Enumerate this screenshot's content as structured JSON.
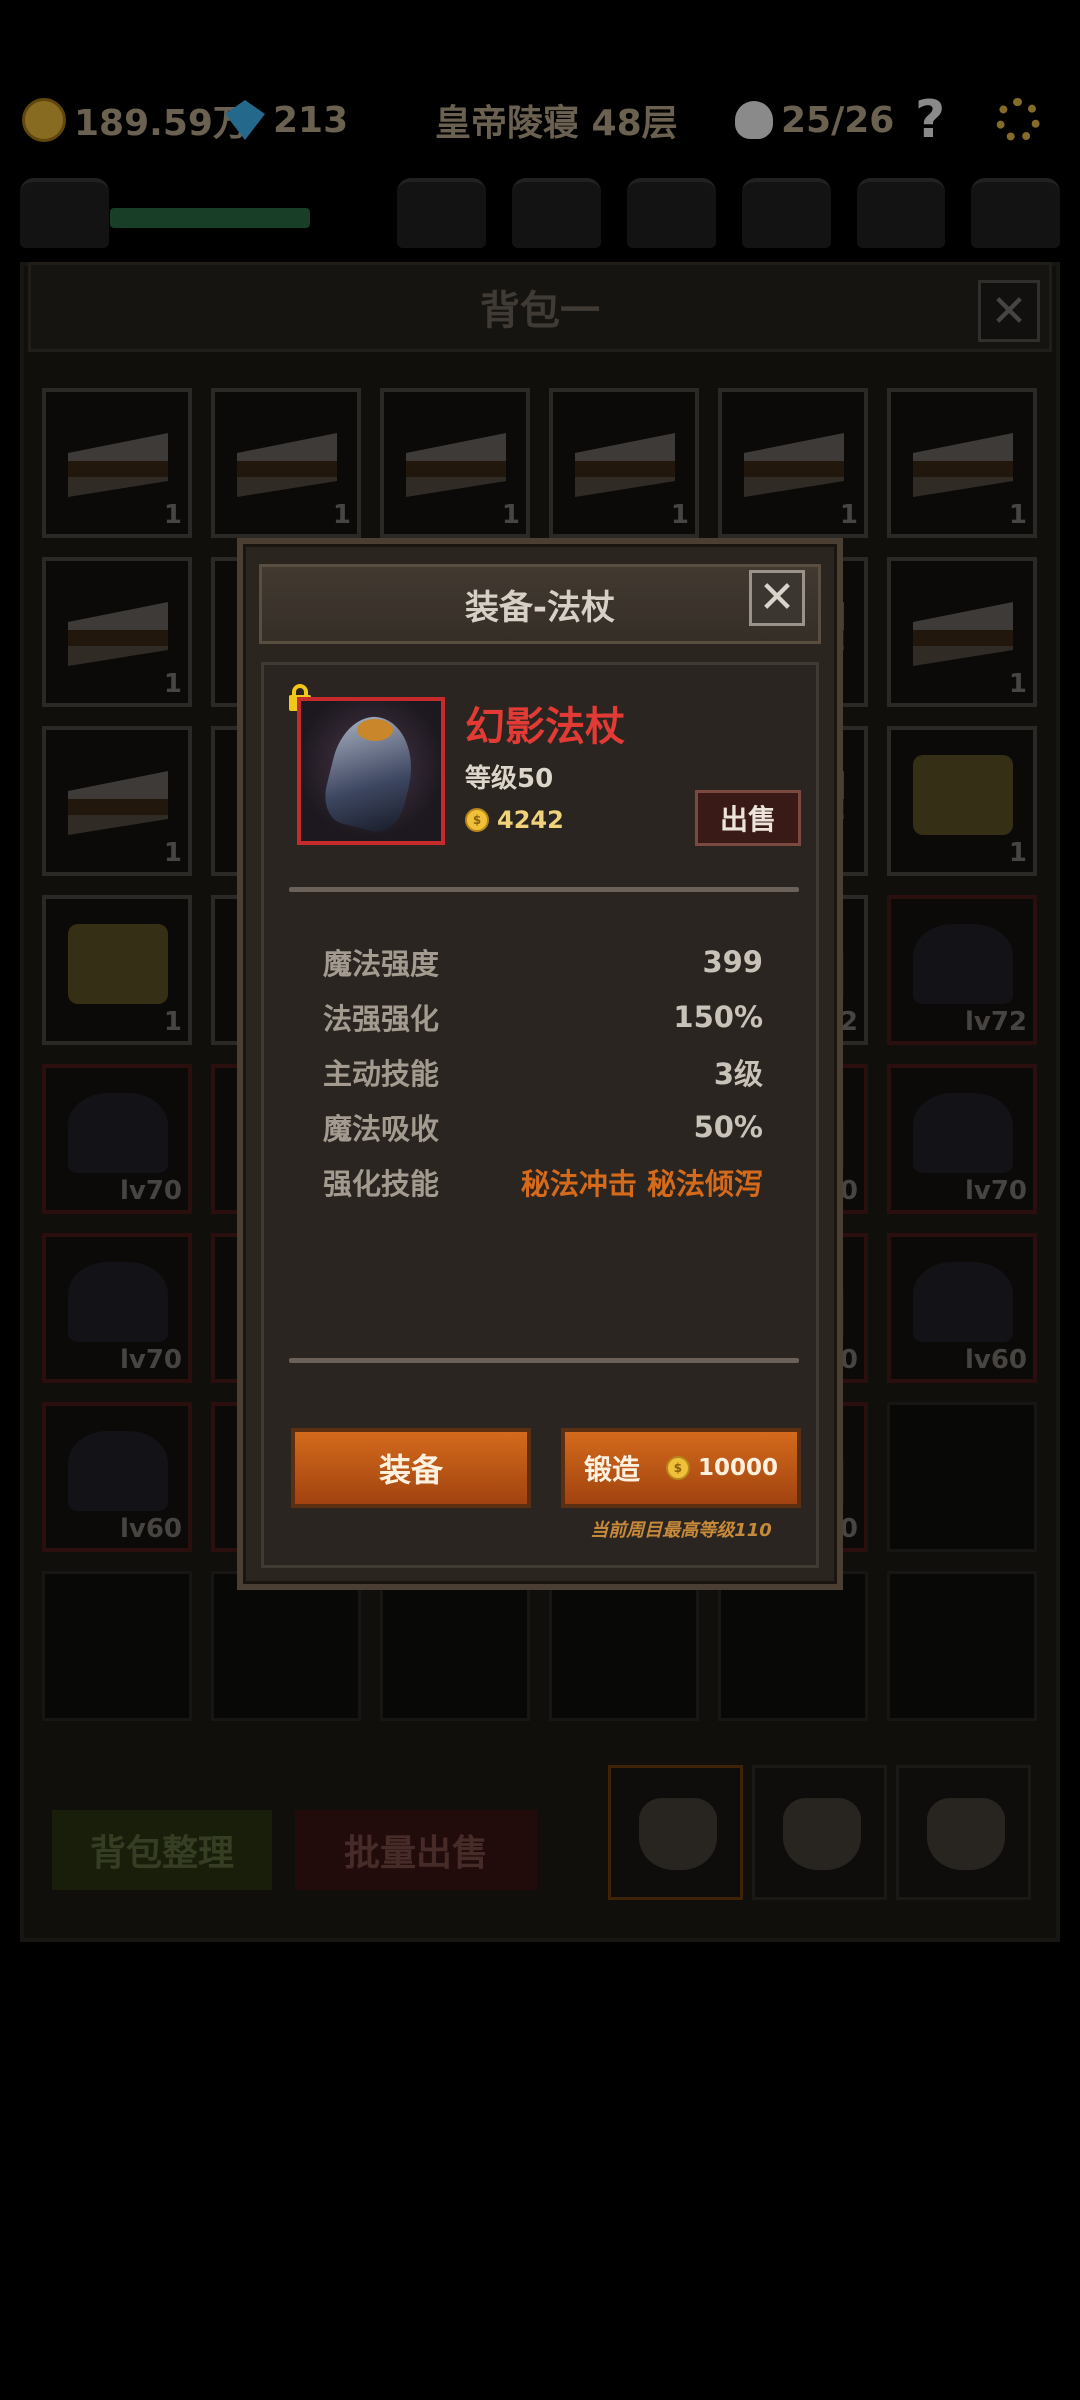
{
  "topbar": {
    "gold": "189.59万",
    "gems": "213",
    "location": "皇帝陵寝 48层",
    "skulls": "25/26",
    "help_label": "?"
  },
  "bag": {
    "title": "背包一",
    "close_label": "✕",
    "sort_label": "背包整理",
    "bulk_sell_label": "批量出售",
    "cells": [
      {
        "type": "cake",
        "label": "1"
      },
      {
        "type": "cake",
        "label": "1"
      },
      {
        "type": "cake",
        "label": "1"
      },
      {
        "type": "cake",
        "label": "1"
      },
      {
        "type": "cake",
        "label": "1"
      },
      {
        "type": "cake",
        "label": "1"
      },
      {
        "type": "cake",
        "label": "1"
      },
      {
        "type": "cake",
        "label": ""
      },
      {
        "type": "cake",
        "label": ""
      },
      {
        "type": "cake",
        "label": ""
      },
      {
        "type": "cake",
        "label": ""
      },
      {
        "type": "cake",
        "label": "1"
      },
      {
        "type": "cake",
        "label": "1"
      },
      {
        "type": "cake",
        "label": ""
      },
      {
        "type": "cake",
        "label": ""
      },
      {
        "type": "cake",
        "label": ""
      },
      {
        "type": "cake",
        "label": ""
      },
      {
        "type": "beer",
        "label": "1"
      },
      {
        "type": "beer",
        "label": "1"
      },
      {
        "type": "gear",
        "label": ""
      },
      {
        "type": "gear",
        "label": ""
      },
      {
        "type": "gear",
        "label": ""
      },
      {
        "type": "gear",
        "label": "2"
      },
      {
        "type": "gear",
        "label": "lv72",
        "red": true
      },
      {
        "type": "gear",
        "label": "lv70",
        "red": true
      },
      {
        "type": "gear",
        "label": "",
        "red": true
      },
      {
        "type": "gear",
        "label": ""
      },
      {
        "type": "gear",
        "label": ""
      },
      {
        "type": "gear",
        "label": "0",
        "red": true
      },
      {
        "type": "gear",
        "label": "lv70",
        "red": true
      },
      {
        "type": "gear",
        "label": "lv70",
        "red": true
      },
      {
        "type": "gear",
        "label": "",
        "red": true
      },
      {
        "type": "gear",
        "label": ""
      },
      {
        "type": "gear",
        "label": ""
      },
      {
        "type": "gear",
        "label": "0",
        "red": true
      },
      {
        "type": "gear",
        "label": "lv60",
        "red": true
      },
      {
        "type": "gear",
        "label": "lv60",
        "red": true
      },
      {
        "type": "gear",
        "label": "",
        "red": true
      },
      {
        "type": "gear",
        "label": ""
      },
      {
        "type": "gear",
        "label": ""
      },
      {
        "type": "gear",
        "label": "0",
        "red": true
      },
      {
        "type": "empty",
        "label": ""
      },
      {
        "type": "empty",
        "label": ""
      },
      {
        "type": "empty",
        "label": ""
      },
      {
        "type": "empty",
        "label": ""
      },
      {
        "type": "empty",
        "label": ""
      },
      {
        "type": "empty",
        "label": ""
      },
      {
        "type": "empty",
        "label": ""
      }
    ]
  },
  "modal": {
    "title": "装备-法杖",
    "close_label": "✕",
    "item": {
      "name": "幻影法杖",
      "level": "等级50",
      "price": "4242",
      "locked": true
    },
    "sell_label": "出售",
    "stats": [
      {
        "label": "魔法强度",
        "value": "399"
      },
      {
        "label": "法强强化",
        "value": "150%"
      },
      {
        "label": "主动技能",
        "value": "3级"
      },
      {
        "label": "魔法吸收",
        "value": "50%"
      },
      {
        "label": "强化技能",
        "value": "秘法冲击 秘法倾泻"
      }
    ],
    "equip_label": "装备",
    "forge_label": "锻造",
    "forge_cost": "10000",
    "max_level_note": "当前周目最高等级110"
  },
  "colors": {
    "item_name": "#e23a34",
    "accent_orange": "#d56a1b",
    "button_orange": "#c85f18",
    "rarity_border": "#c52b2b"
  }
}
